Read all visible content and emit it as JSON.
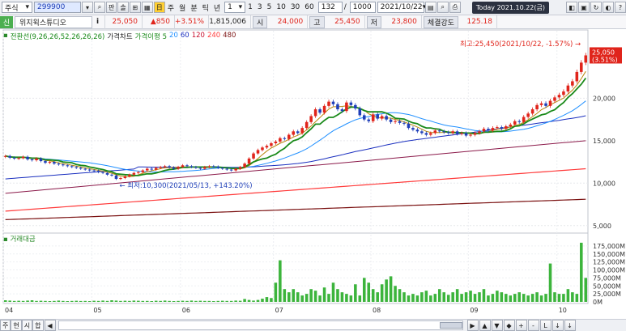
{
  "toolbar": {
    "market": "주식",
    "code": "299900",
    "buttons": [
      "판",
      "솔"
    ],
    "periods": [
      "주",
      "월",
      "분",
      "틱",
      "년"
    ],
    "interval_value": "1",
    "minute_options": [
      "1",
      "3",
      "5",
      "10",
      "30",
      "60"
    ],
    "count": "132",
    "slash": "/",
    "max_count": "1000",
    "date": "2021/10/22",
    "today": "Today  2021.10.22(금)"
  },
  "quote": {
    "tag": "신",
    "name": "위지윅스튜디오",
    "info": "i",
    "price": "25,050",
    "change": "▲850",
    "change_pct": "+3.51%",
    "volume": "1,815,006",
    "open_label": "시",
    "open": "24,000",
    "high_label": "고",
    "high": "25,450",
    "low_label": "저",
    "low": "23,800",
    "strength_label": "체결강도",
    "strength": "125.18"
  },
  "legend": {
    "items": [
      {
        "text": "전환선(9,26,26,52,26,26,26)",
        "color": "#1a8a1a"
      },
      {
        "text": "가격차트",
        "color": "#222222"
      },
      {
        "text": "가격이평 5",
        "color": "#1a8a1a"
      },
      {
        "text": "20",
        "color": "#1f8fff"
      },
      {
        "text": "60",
        "color": "#1a2fbf"
      },
      {
        "text": "120",
        "color": "#c8102e"
      },
      {
        "text": "240",
        "color": "#ff3a3a"
      },
      {
        "text": "480",
        "color": "#7a1010"
      }
    ]
  },
  "volume_legend": "거래대금",
  "annotations": {
    "high": "최고:25,450(2021/10/22, -1.57%)",
    "low": "최저:10,300(2021/05/13, +143.20%)"
  },
  "price_axis": {
    "labels": [
      "20,000",
      "15,000",
      "10,000",
      "5,000"
    ],
    "current": "25,050",
    "current_pct": "(3.51%)"
  },
  "volume_axis": {
    "labels": [
      "175,000M",
      "150,000M",
      "125,000M",
      "100,000M",
      "75,000M",
      "50,000M",
      "25,000M",
      "0M"
    ]
  },
  "x_axis": {
    "labels": [
      "04",
      "05",
      "06",
      "07",
      "08",
      "09",
      "10"
    ]
  },
  "bottom": {
    "tabs": [
      "주",
      "현",
      "시",
      "합"
    ],
    "arrows": [
      "◀",
      "▶",
      "▲",
      "▼",
      "◆",
      "+",
      "-",
      "L",
      "↓",
      "↓"
    ]
  },
  "colors": {
    "up": "#e0241b",
    "down": "#1f3fb8",
    "volume": "#3cb43c",
    "conversion_line": "#1a8a1a",
    "ma5": "#b8860b",
    "ma20": "#1f8fff",
    "ma60": "#1a2fbf",
    "ma120": "#8b1a4a",
    "ma240": "#ff3a3a",
    "ma480": "#7a1010"
  },
  "chart_data": {
    "type": "candlestick",
    "y_range": [
      4500,
      27000
    ],
    "volume_range": [
      0,
      200000
    ],
    "x_ticks": [
      {
        "label": "04",
        "index": 0
      },
      {
        "label": "05",
        "index": 20
      },
      {
        "label": "06",
        "index": 40
      },
      {
        "label": "07",
        "index": 61
      },
      {
        "label": "08",
        "index": 83
      },
      {
        "label": "09",
        "index": 105
      },
      {
        "label": "10",
        "index": 125
      }
    ],
    "close": [
      13200,
      13000,
      12900,
      12950,
      13100,
      12800,
      12700,
      12900,
      12600,
      12400,
      12500,
      12300,
      12200,
      12100,
      12000,
      11900,
      11800,
      11700,
      11600,
      11500,
      11450,
      11300,
      11200,
      11000,
      10900,
      10500,
      10600,
      10800,
      11000,
      11200,
      11300,
      11500,
      11700,
      11600,
      11800,
      11900,
      12000,
      11850,
      11700,
      11900,
      12100,
      12000,
      11900,
      11800,
      11700,
      11900,
      12000,
      11950,
      11800,
      11700,
      11600,
      11500,
      11700,
      11900,
      12300,
      12900,
      13500,
      13900,
      14200,
      14400,
      14700,
      14900,
      15300,
      15200,
      15700,
      16100,
      15900,
      16500,
      17200,
      17900,
      18700,
      18300,
      19100,
      19600,
      19300,
      18700,
      18500,
      19500,
      19200,
      18800,
      18000,
      17500,
      17300,
      18100,
      17600,
      17900,
      17500,
      17200,
      17300,
      17100,
      17000,
      16500,
      16300,
      16100,
      15900,
      15700,
      15900,
      16200,
      16100,
      16000,
      15900,
      16100,
      15800,
      15900,
      15600,
      15700,
      15900,
      16100,
      16400,
      16200,
      16500,
      16600,
      16400,
      16700,
      16900,
      17300,
      17200,
      17800,
      18200,
      18700,
      19200,
      19400,
      19100,
      19700,
      20100,
      20400,
      20800,
      21500,
      22000,
      23100,
      24200,
      25050
    ],
    "volume": [
      5000,
      4000,
      3000,
      3500,
      3000,
      4000,
      5000,
      3000,
      3500,
      3000,
      2500,
      3000,
      4000,
      3000,
      2500,
      3000,
      3500,
      2800,
      3000,
      2500,
      3500,
      3000,
      4000,
      3000,
      5000,
      4000,
      3000,
      3500,
      3000,
      4000,
      3500,
      3000,
      3000,
      2500,
      3500,
      3000,
      4000,
      3000,
      2500,
      3000,
      3500,
      3000,
      4000,
      3000,
      3500,
      3000,
      3000,
      2500,
      3000,
      3500,
      3000,
      3000,
      4000,
      3500,
      9000,
      6000,
      4000,
      6000,
      10000,
      15000,
      12000,
      60000,
      130000,
      40000,
      30000,
      40000,
      30000,
      20000,
      25000,
      40000,
      35000,
      20000,
      45000,
      25000,
      60000,
      40000,
      30000,
      25000,
      20000,
      55000,
      20000,
      75000,
      60000,
      40000,
      30000,
      55000,
      70000,
      80000,
      50000,
      40000,
      30000,
      20000,
      25000,
      20000,
      30000,
      35000,
      20000,
      25000,
      40000,
      30000,
      22000,
      30000,
      40000,
      25000,
      30000,
      35000,
      25000,
      30000,
      40000,
      20000,
      25000,
      35000,
      30000,
      25000,
      20000,
      25000,
      30000,
      25000,
      20000,
      25000,
      30000,
      20000,
      25000,
      120000,
      30000,
      25000,
      25000,
      40000,
      30000,
      25000,
      185000,
      75000,
      40000
    ]
  }
}
